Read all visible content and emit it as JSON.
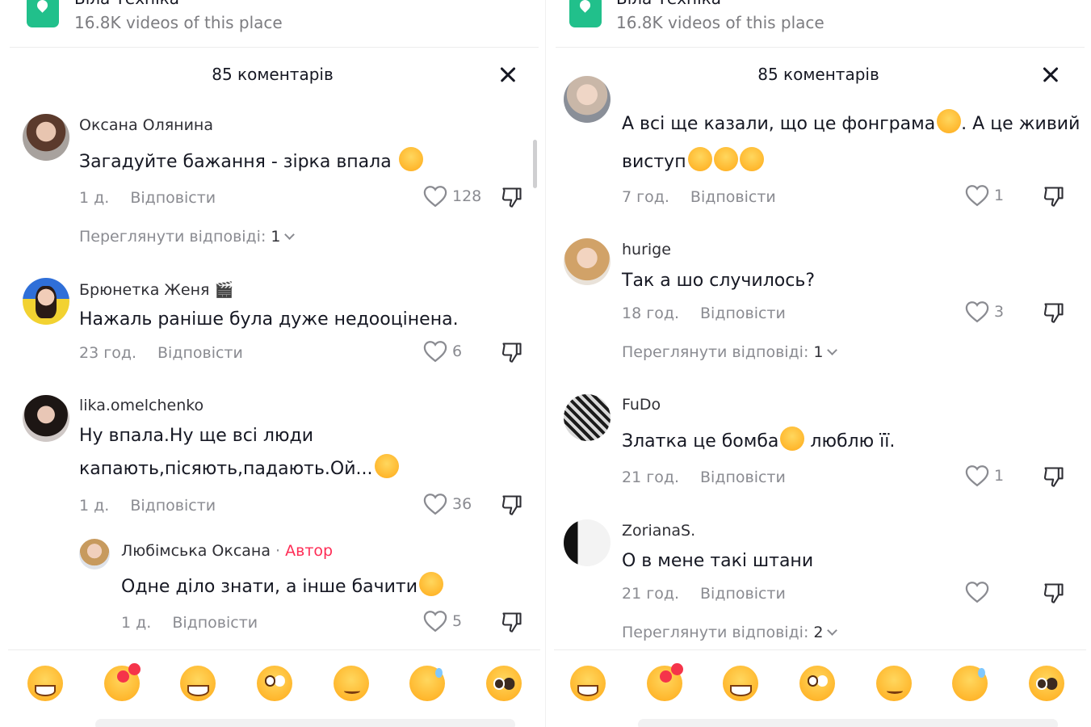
{
  "left": {
    "location": {
      "name": "Біла Техніка",
      "videos": "16.8K videos of this place"
    },
    "title": "85 коментарів",
    "comments": [
      {
        "username": "Оксана Олянина",
        "lines": [
          "Загадуйте бажання - зірка впала"
        ],
        "time": "1 д.",
        "reply": "Відповісти",
        "likes": "128",
        "view_replies": "Переглянути відповіді: ",
        "view_replies_count": "1"
      },
      {
        "username": "Брюнетка Женя 🎬",
        "lines": [
          "Нажаль раніше була дуже недооцінена."
        ],
        "time": "23 год.",
        "reply": "Відповісти",
        "likes": "6"
      },
      {
        "username": "lika.omelchenko",
        "lines": [
          "Ну впала.Ну ще всі люди",
          "капають,пісяють,падають.Ой..."
        ],
        "time": "1 д.",
        "reply": "Відповісти",
        "likes": "36"
      }
    ],
    "reply": {
      "username": "Любімська Оксана",
      "separator": " · ",
      "badge": "Автор",
      "text": "Одне діло знати, а інше бачити",
      "time": "1 д.",
      "reply": "Відповісти",
      "likes": "5"
    }
  },
  "right": {
    "location": {
      "name": "Біла Техніка",
      "videos": "16.8K videos of this place"
    },
    "title": "85 коментарів",
    "comments": [
      {
        "username": "",
        "lines": [
          "А всі ще казали, що це фонграма",
          ". А це живий",
          "виступ"
        ],
        "time": "7 год.",
        "reply": "Відповісти",
        "likes": "1"
      },
      {
        "username": "hurige",
        "lines": [
          "Так а шо случилось?"
        ],
        "time": "18 год.",
        "reply": "Відповісти",
        "likes": "3",
        "view_replies": "Переглянути відповіді: ",
        "view_replies_count": "1"
      },
      {
        "username": "FuDo",
        "lines": [
          "Златка це бомба",
          " люблю її."
        ],
        "time": "21 год.",
        "reply": "Відповісти",
        "likes": "1"
      },
      {
        "username": "ZorianaS.",
        "lines": [
          "О в мене такі штани"
        ],
        "time": "21 год.",
        "reply": "Відповісти",
        "likes": "",
        "view_replies": "Переглянути відповіді: ",
        "view_replies_count": "2"
      }
    ]
  },
  "emoji_bar": [
    "grinning-face-icon",
    "smiling-face-with-hearts-icon",
    "face-with-tears-of-joy-icon",
    "flushed-face-icon",
    "smirking-face-icon",
    "grinning-face-with-sweat-icon",
    "pleading-face-icon"
  ],
  "colors": {
    "author_badge": "#fe2c55",
    "secondary_text": "#8a8b91",
    "location_icon": "#21c08b"
  }
}
